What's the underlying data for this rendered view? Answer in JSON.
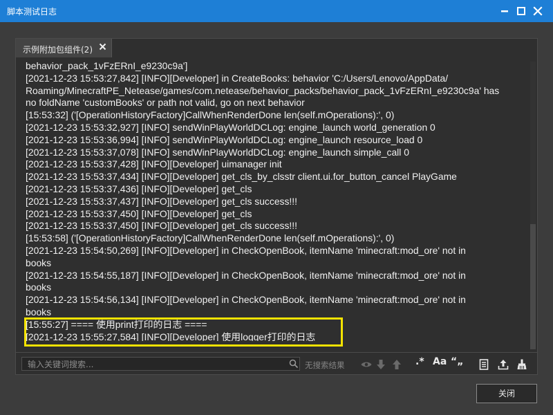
{
  "window": {
    "title": "脚本测试日志"
  },
  "tab": {
    "label": "示例附加包组件(2)"
  },
  "log": {
    "lines": [
      "behavior_pack_1vFzERnI_e9230c9a']",
      "[2021-12-23 15:53:27,842] [INFO][Developer] in CreateBooks: behavior 'C:/Users/Lenovo/AppData/",
      "Roaming/MinecraftPE_Netease/games/com.netease/behavior_packs/behavior_pack_1vFzERnI_e9230c9a' has",
      "no foldName 'customBooks' or path not valid, go on next behavior",
      "[15:53:32] ('[OperationHistoryFactory]CallWhenRenderDone len(self.mOperations):', 0)",
      "[2021-12-23 15:53:32,927] [INFO] sendWinPlayWorldDCLog: engine_launch world_generation 0",
      "[2021-12-23 15:53:36,994] [INFO] sendWinPlayWorldDCLog: engine_launch resource_load 0",
      "[2021-12-23 15:53:37,078] [INFO] sendWinPlayWorldDCLog: engine_launch simple_call 0",
      "[2021-12-23 15:53:37,428] [INFO][Developer] uimanager init",
      "[2021-12-23 15:53:37,434] [INFO][Developer] get_cls_by_clsstr client.ui.for_button_cancel PlayGame",
      "[2021-12-23 15:53:37,436] [INFO][Developer] get_cls",
      "[2021-12-23 15:53:37,437] [INFO][Developer] get_cls success!!!",
      "[2021-12-23 15:53:37,450] [INFO][Developer] get_cls",
      "[2021-12-23 15:53:37,450] [INFO][Developer] get_cls success!!!",
      "[15:53:58] ('[OperationHistoryFactory]CallWhenRenderDone len(self.mOperations):', 0)",
      "[2021-12-23 15:54:50,269] [INFO][Developer] in CheckOpenBook, itemName 'minecraft:mod_ore' not in",
      "books",
      "[2021-12-23 15:54:55,187] [INFO][Developer] in CheckOpenBook, itemName 'minecraft:mod_ore' not in",
      "books",
      "[2021-12-23 15:54:56,134] [INFO][Developer] in CheckOpenBook, itemName 'minecraft:mod_ore' not in",
      "books",
      "[15:55:27] ==== 使用print打印的日志 ====",
      "[2021-12-23 15:55:27,584] [INFO][Developer] 使用logger打印的日志"
    ]
  },
  "search": {
    "placeholder": "输入关键词搜索...",
    "no_result": "无搜索结果"
  },
  "toolbar": {
    "regex_label": ".*",
    "case_label": "Aa",
    "word_label": "“„"
  },
  "footer": {
    "close_label": "关闭"
  },
  "colors": {
    "title_bar": "#1e7fd6",
    "highlight_border": "#f5e300"
  }
}
